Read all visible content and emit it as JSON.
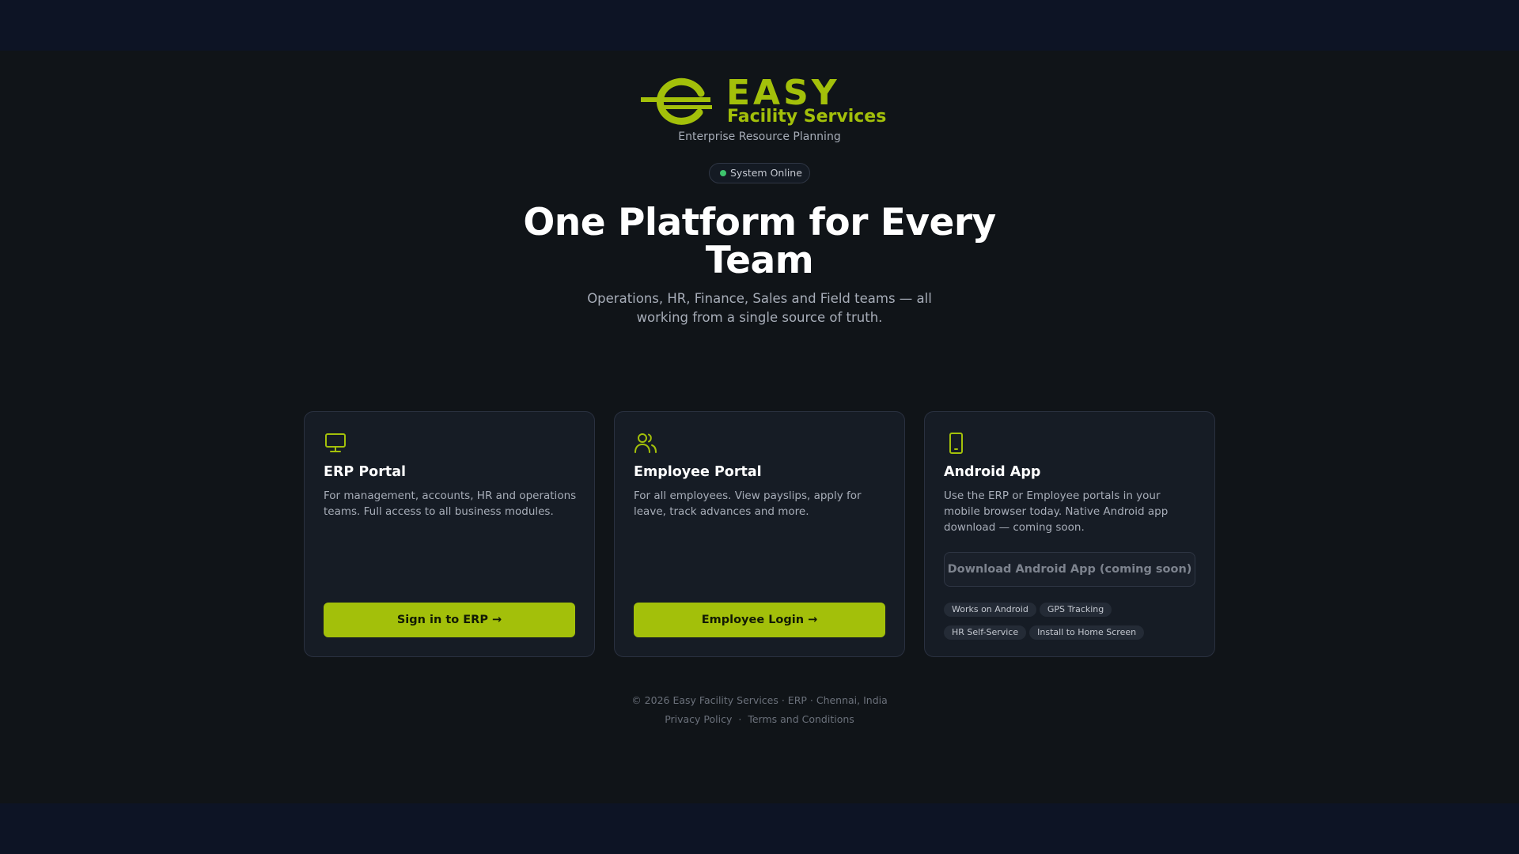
{
  "brand": {
    "word1": "EASY",
    "word2": "Facility Services",
    "tagline": "Enterprise Resource Planning",
    "accent_color": "#a3c00a"
  },
  "status": {
    "label": "System Online",
    "color": "#3ec46d"
  },
  "hero": {
    "headline": "One Platform for Every Team",
    "subheadline": "Operations, HR, Finance, Sales and Field teams — all working from a single source of truth."
  },
  "cards": [
    {
      "icon": "monitor-icon",
      "title": "ERP Portal",
      "description": "For management, accounts, HR and operations teams. Full access to all business modules.",
      "button_label": "Sign in to ERP →"
    },
    {
      "icon": "users-icon",
      "title": "Employee Portal",
      "description": "For all employees. View payslips, apply for leave, track advances and more.",
      "button_label": "Employee Login →"
    },
    {
      "icon": "smartphone-icon",
      "title": "Android App",
      "description": "Use the ERP or Employee portals in your mobile browser today. Native Android app download — coming soon.",
      "button_label": "Download Android App (coming soon)",
      "tags": [
        "Works on Android",
        "GPS Tracking",
        "HR Self-Service",
        "Install to Home Screen"
      ]
    }
  ],
  "footer": {
    "copyright": "© 2026 Easy Facility Services · ERP · Chennai, India",
    "links": [
      "Privacy Policy",
      "Terms and Conditions"
    ],
    "separator": "·"
  }
}
